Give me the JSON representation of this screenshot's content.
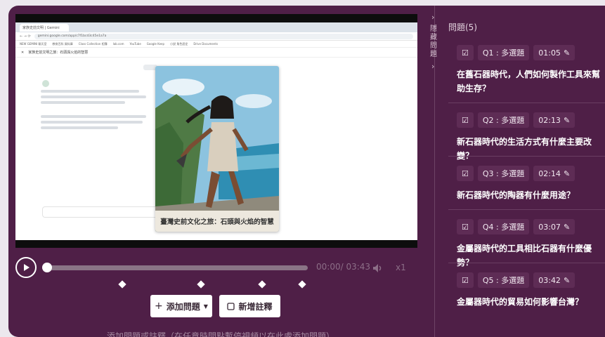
{
  "video": {
    "browser_tab": "家族史前文明 | Gemini",
    "url": "gemini.google.com/app/c7f1bcd3c45e1a7a",
    "bookmarks": [
      "NEW GEMINI 聊天室",
      "教育百科 資料庫",
      "Class Collection 相簿",
      "lab.com",
      "YouTube",
      "Google Keep",
      "小說 角色設定",
      "Drive Documents"
    ],
    "app_title": "家族史前文明之旅：石頭與火焰的智慧",
    "cover_title": "臺灣史前文化之旅：石頭與火焰的智慧"
  },
  "player": {
    "time": "00:00/ 03:43",
    "speed": "x1"
  },
  "buttons": {
    "add_question": "添加問題",
    "add_note": "新增註釋"
  },
  "bottom_hint": "添加問題或註釋（在任意時間點暫停視頻以在此處添加問題）",
  "side_label": "隱藏問題",
  "questions_header": "問題(5)",
  "questions": [
    {
      "label": "Q1 : 多選題",
      "time": "01:05",
      "text": "在舊石器時代，人們如何製作工具來幫助生存？"
    },
    {
      "label": "Q2 : 多選題",
      "time": "02:13",
      "text": "新石器時代的生活方式有什麼主要改變？"
    },
    {
      "label": "Q3 : 多選題",
      "time": "02:14",
      "text": "新石器時代的陶器有什麼用途？"
    },
    {
      "label": "Q4 : 多選題",
      "time": "03:07",
      "text": "金屬器時代的工具相比石器有什麼優勢？"
    },
    {
      "label": "Q5 : 多選題",
      "time": "03:42",
      "text": "金屬器時代的貿易如何影響台灣？"
    }
  ],
  "colors": {
    "panel": "#4f1f47",
    "pill": "#5e2c55",
    "muted_text": "#8c6e87"
  },
  "icons": [
    "play-icon",
    "volume-icon",
    "plus-icon",
    "caret-down-icon",
    "note-icon",
    "checkbox-icon",
    "edit-icon",
    "chevron-right-icon"
  ]
}
